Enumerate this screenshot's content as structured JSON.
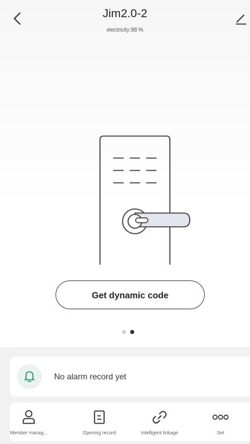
{
  "header": {
    "title": "Jim2.0-2",
    "subtitle": "electricity:98 %"
  },
  "main": {
    "dynamic_code_button": "Get dynamic code",
    "pager": {
      "count": 2,
      "active_index": 1
    }
  },
  "alarm": {
    "message": "No alarm record yet",
    "icon": "bell-icon",
    "icon_color": "#2e9b6b"
  },
  "bottom_nav": {
    "items": [
      {
        "label": "Member manag...",
        "icon": "person-icon"
      },
      {
        "label": "Opening record",
        "icon": "document-icon"
      },
      {
        "label": "Intelligent linkage",
        "icon": "link-icon"
      },
      {
        "label": "Set",
        "icon": "more-dots-icon"
      }
    ]
  },
  "colors": {
    "background": "#f1f1f1",
    "text": "#222222",
    "accent_green": "#2e9b6b"
  }
}
